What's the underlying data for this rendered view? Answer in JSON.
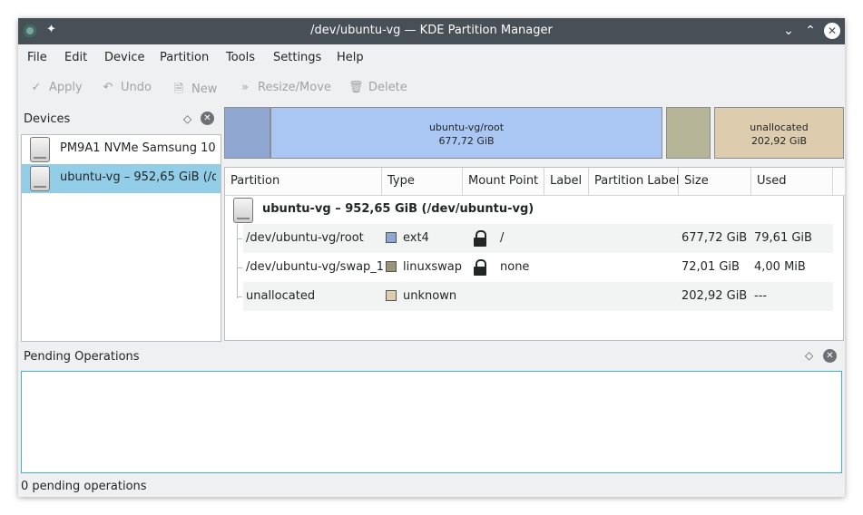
{
  "window": {
    "title": "/dev/ubuntu-vg — KDE Partition Manager",
    "icons": {
      "app": "kde-partition-manager-icon",
      "pin": "pin-icon",
      "minimize": "chevron-down-icon",
      "maximize": "chevron-up-icon",
      "close": "close-icon"
    }
  },
  "menubar": {
    "items": [
      "File",
      "Edit",
      "Device",
      "Partition",
      "Tools",
      "Settings",
      "Help"
    ]
  },
  "toolbar": {
    "apply": "Apply",
    "undo": "Undo",
    "new": "New",
    "resize_move": "Resize/Move",
    "delete": "Delete",
    "disabled_color": "#a0a3a5"
  },
  "devices": {
    "title": "Devices",
    "items": [
      {
        "label": "PM9A1 NVMe Samsung 10...",
        "selected": false
      },
      {
        "label": "ubuntu-vg – 952,65 GiB (/d...",
        "selected": true
      }
    ]
  },
  "partition_bar": {
    "segments": [
      {
        "name": "",
        "size": "",
        "color": "#8fa7d1",
        "kind": "ext4-small"
      },
      {
        "name": "ubuntu-vg/root",
        "size": "677,72 GiB",
        "color": "#a9c7f2",
        "kind": "ext4"
      },
      {
        "name": "",
        "size": "",
        "color": "#b5b496",
        "kind": "linuxswap"
      },
      {
        "name": "unallocated",
        "size": "202,92 GiB",
        "color": "#ddccae",
        "kind": "unknown"
      }
    ]
  },
  "table": {
    "headers": [
      "Partition",
      "Type",
      "Mount Point",
      "Label",
      "Partition Label",
      "Size",
      "Used"
    ],
    "device_row": "ubuntu-vg – 952,65 GiB (/dev/ubuntu-vg)",
    "rows": [
      {
        "partition": "/dev/ubuntu-vg/root",
        "type": "ext4",
        "type_color": "#8fa7d1",
        "locked": true,
        "mount": "/",
        "label": "",
        "plabel": "",
        "size": "677,72 GiB",
        "used": "79,61 GiB"
      },
      {
        "partition": "/dev/ubuntu-vg/swap_1",
        "type": "linuxswap",
        "type_color": "#9a9577",
        "locked": true,
        "mount": "none",
        "label": "",
        "plabel": "",
        "size": "72,01 GiB",
        "used": "4,00 MiB"
      },
      {
        "partition": "unallocated",
        "type": "unknown",
        "type_color": "#ddccae",
        "locked": false,
        "mount": "",
        "label": "",
        "plabel": "",
        "size": "202,92 GiB",
        "used": "---"
      }
    ]
  },
  "pending": {
    "title": "Pending Operations"
  },
  "status": {
    "text": "0 pending operations"
  }
}
